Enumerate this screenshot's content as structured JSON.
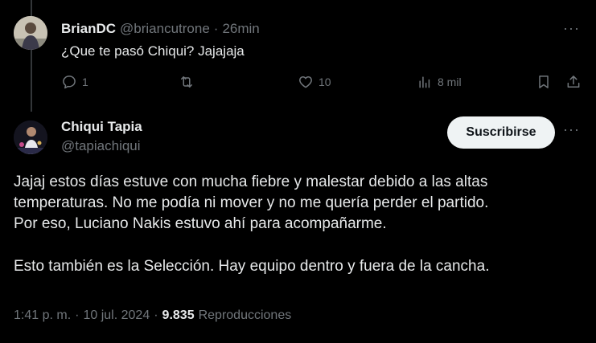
{
  "reply": {
    "author_name": "BrianDC",
    "author_handle": "@briancutrone",
    "separator": "·",
    "time_ago": "26min",
    "text": "¿Que te pasó Chiqui? Jajajaja",
    "more_label": "···",
    "actions": {
      "reply_count": "1",
      "retweet_count": "",
      "like_count": "10",
      "views_count": "8 mil"
    }
  },
  "main": {
    "author_name": "Chiqui Tapia",
    "author_handle": "@tapiachiqui",
    "subscribe_label": "Suscribirse",
    "more_label": "···",
    "paragraphs": [
      "Jajaj estos días estuve con mucha fiebre y malestar debido a las altas",
      "temperaturas. No me podía ni mover y no me quería perder el partido.",
      "Por eso, Luciano Nakis estuvo ahí para acompañarme.",
      "Esto también es la Selección. Hay equipo dentro y fuera de la cancha."
    ],
    "meta": {
      "time": "1:41 p. m.",
      "dot1": "·",
      "date": "10 jul. 2024",
      "dot2": "·",
      "views": "9.835",
      "views_label": "Reproducciones"
    }
  },
  "colors": {
    "background": "#000000",
    "text": "#e7e9ea",
    "muted": "#71767b",
    "button_bg": "#eff3f4"
  }
}
